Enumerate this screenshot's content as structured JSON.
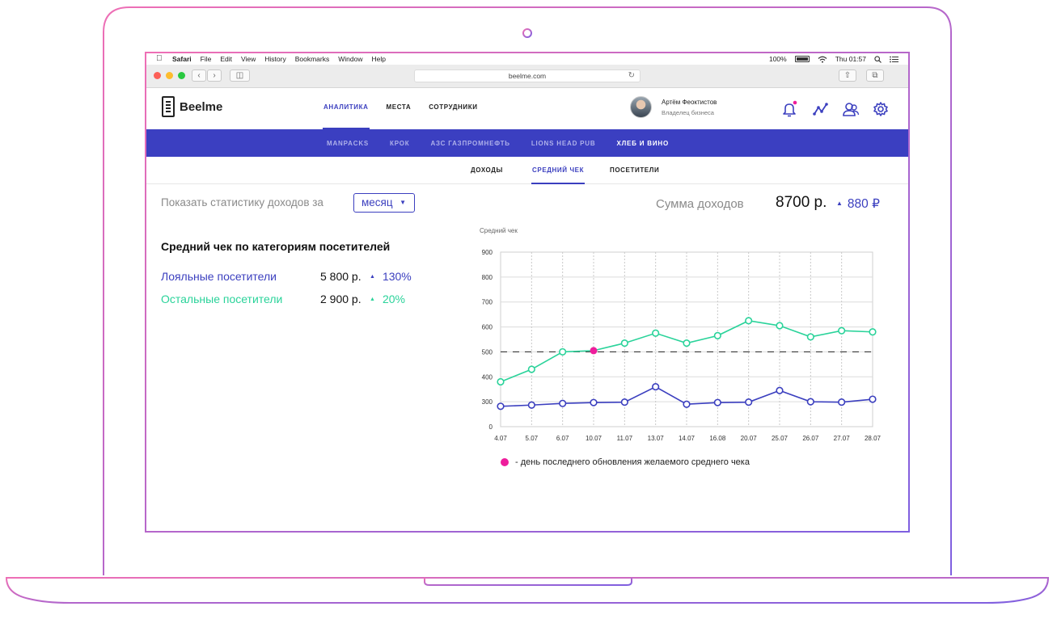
{
  "menubar": {
    "app": "Safari",
    "items": [
      "File",
      "Edit",
      "View",
      "History",
      "Bookmarks",
      "Window",
      "Help"
    ],
    "battery": "100%",
    "clock": "Thu 01:57"
  },
  "browser": {
    "url": "beelme.com"
  },
  "header": {
    "logo": "Beelme",
    "nav": [
      "АНАЛИТИКА",
      "МЕСТА",
      "СОТРУДНИКИ"
    ],
    "user_name": "Артём Феоктистов",
    "user_role": "Владелец бизнеса"
  },
  "places": [
    "MANPACKS",
    "КРОК",
    "АЗС ГАЗПРОМНЕФТЬ",
    "LIONS HEAD PUB",
    "ХЛЕБ И ВИНО"
  ],
  "subtabs": [
    "ДОХОДЫ",
    "СРЕДНИЙ ЧЕК",
    "ПОСЕТИТЕЛИ"
  ],
  "filter": {
    "label": "Показать статистику доходов за",
    "period": "месяц"
  },
  "summary": {
    "label": "Сумма доходов",
    "value": "8700 р.",
    "delta": "880 ₽"
  },
  "categories": {
    "title": "Средний чек по категориям посетителей",
    "rows": [
      {
        "name": "Лояльные посетители",
        "value": "5 800 р.",
        "delta": "130%"
      },
      {
        "name": "Остальные посетители",
        "value": "2 900 р.",
        "delta": "20%"
      }
    ]
  },
  "legend": {
    "text": "- день последнего обновления желаемого среднего чека"
  },
  "colors": {
    "accent": "#3b3fbf",
    "green": "#2ad39a",
    "highlight": "#ee1d9c",
    "bar": "#3b3fc1"
  },
  "chart_data": {
    "type": "line",
    "ylabel": "Средний чек",
    "x": [
      "4.07",
      "5.07",
      "6.07",
      "10.07",
      "11.07",
      "13.07",
      "14.07",
      "16.08",
      "20.07",
      "25.07",
      "26.07",
      "27.07",
      "28.07"
    ],
    "yticks": [
      "0",
      "300",
      "400",
      "500",
      "600",
      "700",
      "800",
      "900"
    ],
    "series": [
      {
        "color": "#2ad39a",
        "values": [
          380,
          430,
          500,
          505,
          535,
          575,
          535,
          565,
          625,
          605,
          560,
          585,
          580
        ]
      },
      {
        "color": "#3b3fbf",
        "values": [
          245,
          260,
          280,
          290,
          295,
          360,
          270,
          290,
          295,
          345,
          300,
          295,
          310
        ]
      }
    ],
    "reference_line": 500,
    "highlight": {
      "x": "10.07",
      "value": 505
    },
    "grid": true
  }
}
